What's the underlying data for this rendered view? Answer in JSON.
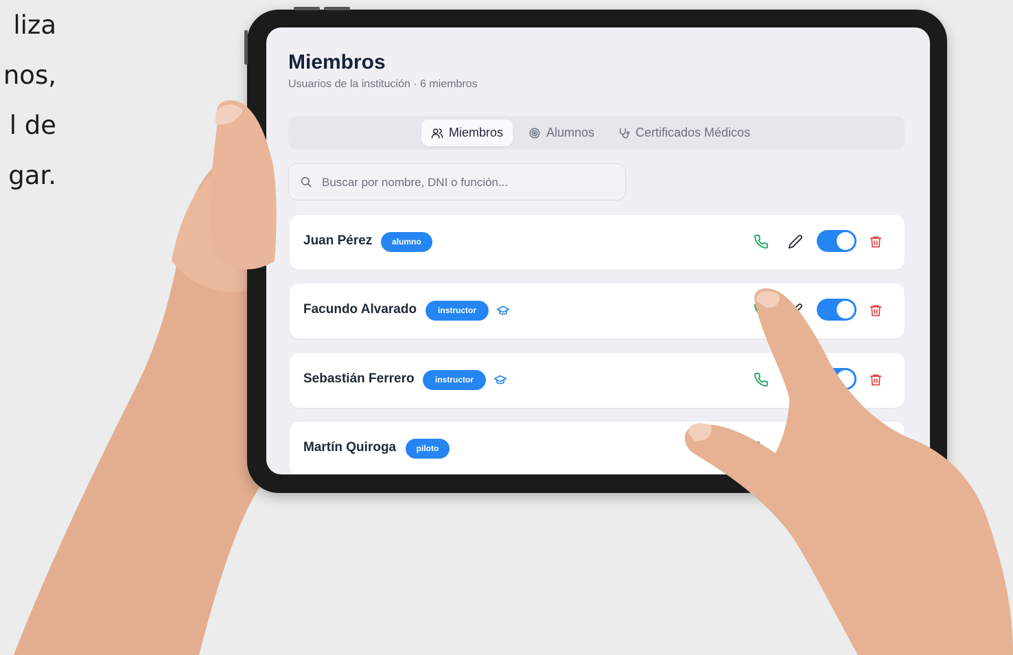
{
  "background_text": [
    "liza",
    "nos,",
    "l de",
    "gar."
  ],
  "header": {
    "title": "Miembros",
    "subtitle": "Usuarios de la institución · 6 miembros"
  },
  "tabs": [
    {
      "label": "Miembros",
      "icon": "users-icon",
      "active": true
    },
    {
      "label": "Alumnos",
      "icon": "target-icon",
      "active": false
    },
    {
      "label": "Certificados Médicos",
      "icon": "stethoscope-icon",
      "active": false
    }
  ],
  "search": {
    "placeholder": "Buscar por nombre, DNI o función..."
  },
  "members": [
    {
      "name": "Juan Pérez",
      "role": "alumno",
      "instructor_icon": false,
      "active": true
    },
    {
      "name": "Facundo Alvarado",
      "role": "instructor",
      "instructor_icon": true,
      "active": true
    },
    {
      "name": "Sebastián Ferrero",
      "role": "instructor",
      "instructor_icon": true,
      "active": true
    },
    {
      "name": "Martín Quiroga",
      "role": "piloto",
      "instructor_icon": false,
      "active": null
    }
  ],
  "colors": {
    "accent": "#2585f2",
    "phone": "#22a55b",
    "delete": "#e53e3e",
    "title": "#16213b"
  }
}
